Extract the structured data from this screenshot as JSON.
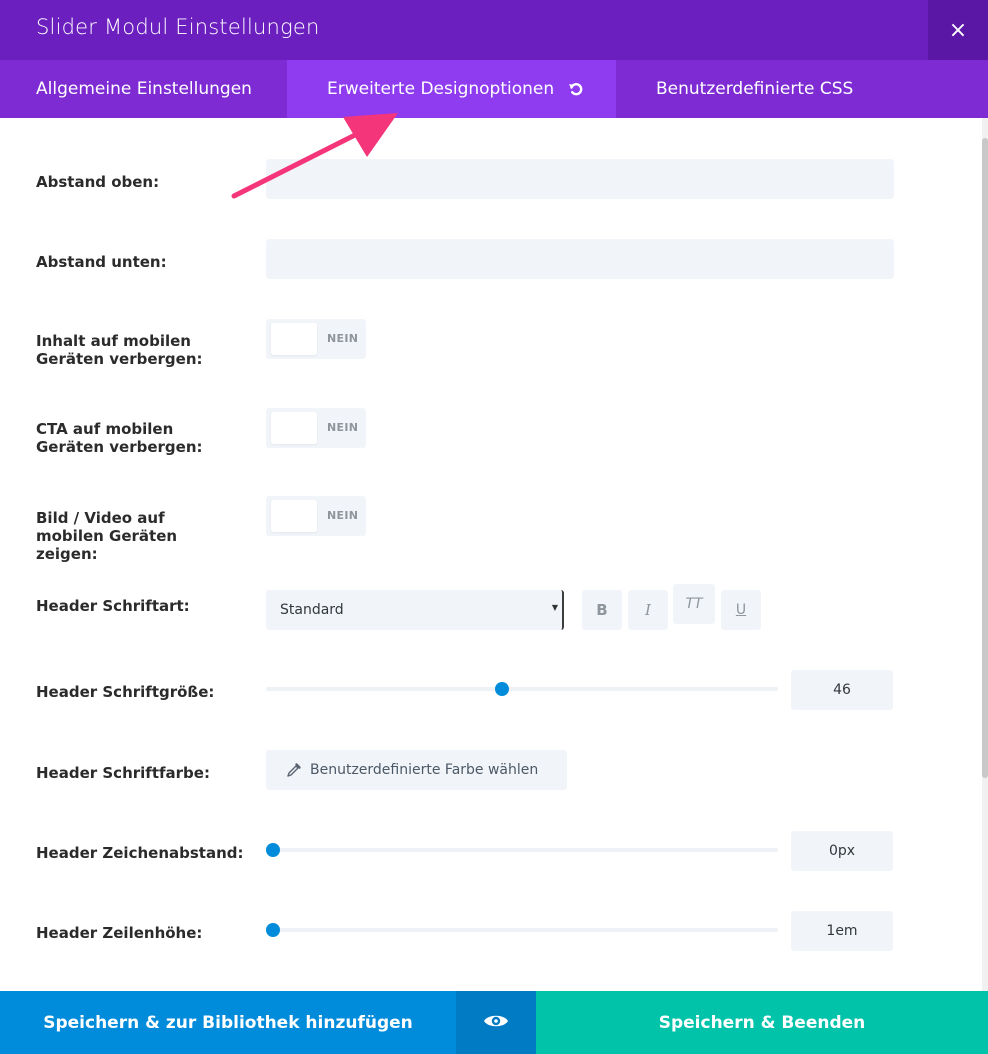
{
  "window": {
    "title": "Slider Modul Einstellungen",
    "close_glyph": "×"
  },
  "tabs": [
    {
      "label": "Allgemeine Einstellungen",
      "active": false
    },
    {
      "label": "Erweiterte Designoptionen",
      "active": true,
      "icon": "reset-icon"
    },
    {
      "label": "Benutzerdefinierte CSS",
      "active": false
    }
  ],
  "fields": {
    "padding_top": {
      "label": "Abstand oben:",
      "value": ""
    },
    "padding_bottom": {
      "label": "Abstand unten:",
      "value": ""
    },
    "hide_content_mobile": {
      "label": "Inhalt auf mobilen Geräten verbergen:",
      "state": "NEIN"
    },
    "hide_cta_mobile": {
      "label": "CTA auf mobilen Geräten verbergen:",
      "state": "NEIN"
    },
    "show_image_mobile": {
      "label": "Bild / Video auf mobilen Geräten zeigen:",
      "state": "NEIN"
    },
    "header_font": {
      "label": "Header Schriftart:",
      "value": "Standard",
      "buttons": {
        "bold": "B",
        "italic": "I",
        "uppercase": "TT",
        "underline": "U"
      }
    },
    "header_font_size": {
      "label": "Header Schriftgröße:",
      "value": "46",
      "slider_fraction": 0.46
    },
    "header_font_color": {
      "label": "Header Schriftfarbe:",
      "button_label": "Benutzerdefinierte Farbe wählen"
    },
    "header_letter_spacing": {
      "label": "Header Zeichenabstand:",
      "value": "0px",
      "slider_fraction": 0.0
    },
    "header_line_height": {
      "label": "Header Zeilenhöhe:",
      "value": "1em",
      "slider_fraction": 0.0
    }
  },
  "footer": {
    "save_library_label": "Speichern & zur Bibliothek hinzufügen",
    "preview_icon": "eye-icon",
    "save_exit_label": "Speichern & Beenden"
  },
  "colors": {
    "title_bar": "#6c1fbf",
    "tab_bar": "#7e2bd3",
    "active_tab": "#8f3bf0",
    "slider_handle": "#008bdb",
    "footer_blue": "#008bdb",
    "footer_teal": "#00c3aa",
    "annotation_arrow": "#f5357a"
  }
}
